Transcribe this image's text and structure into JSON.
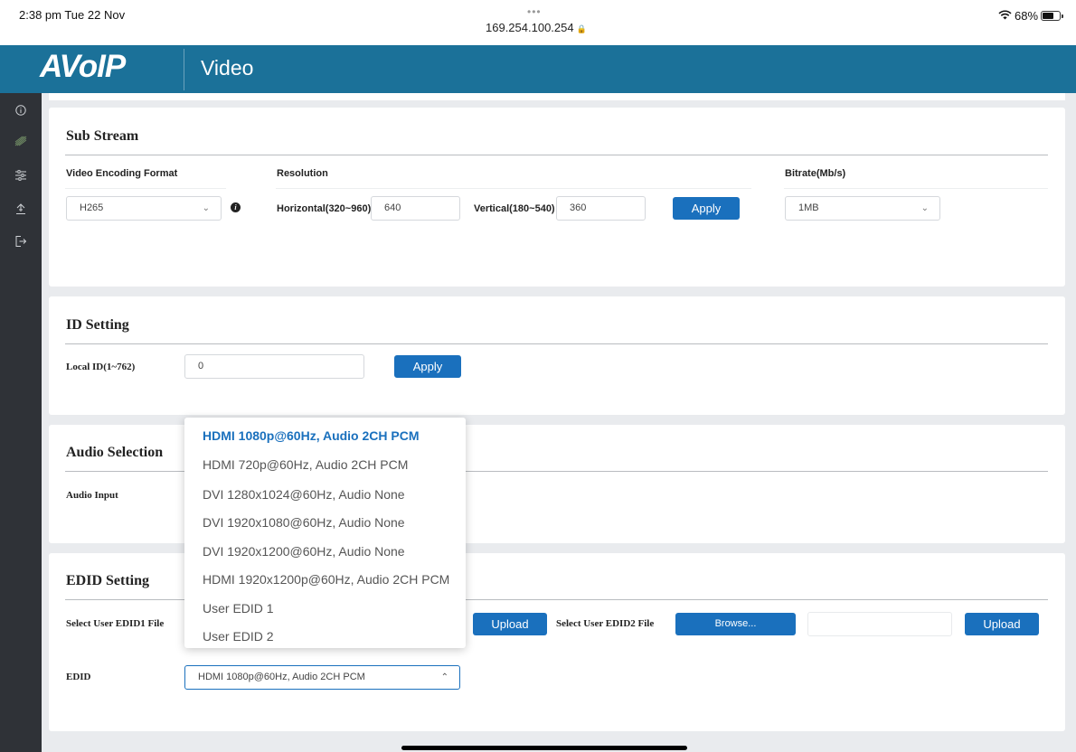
{
  "status_bar": {
    "time": "2:38 pm  Tue 22 Nov",
    "dots": "•••",
    "url": "169.254.100.254",
    "battery": "68%",
    "battery_level": 0.68
  },
  "header": {
    "logo": "AVoIP",
    "title": "Video"
  },
  "sidebar": {
    "items": [
      {
        "icon": "info-icon"
      },
      {
        "icon": "video-icon"
      },
      {
        "icon": "sliders-icon"
      },
      {
        "icon": "upgrade-icon"
      },
      {
        "icon": "logout-icon"
      }
    ]
  },
  "sub_stream": {
    "title": "Sub Stream",
    "encoding_label": "Video Encoding Format",
    "encoding_value": "H265",
    "resolution_label": "Resolution",
    "horizontal_label": "Horizontal(320~960)",
    "horizontal_value": "640",
    "vertical_label": "Vertical(180~540)",
    "vertical_value": "360",
    "apply_label": "Apply",
    "bitrate_label": "Bitrate(Mb/s)",
    "bitrate_value": "1MB"
  },
  "id_setting": {
    "title": "ID Setting",
    "local_id_label": "Local ID(1~762)",
    "local_id_value": "0",
    "apply_label": "Apply"
  },
  "audio_selection": {
    "title": "Audio Selection",
    "audio_input_label": "Audio Input"
  },
  "edid_setting": {
    "title": "EDID Setting",
    "edid1_label": "Select User EDID1 File",
    "upload1_label": "Upload",
    "edid2_label": "Select User EDID2 File",
    "browse_label": "Browse...",
    "upload2_label": "Upload",
    "edid_label": "EDID",
    "edid_value": "HDMI 1080p@60Hz, Audio 2CH PCM"
  },
  "edid_dropdown": {
    "options": [
      "HDMI 1080p@60Hz, Audio 2CH PCM",
      "HDMI 720p@60Hz, Audio 2CH PCM",
      "DVI 1280x1024@60Hz, Audio None",
      "DVI 1920x1080@60Hz, Audio None",
      "DVI 1920x1200@60Hz, Audio None",
      "HDMI 1920x1200p@60Hz, Audio 2CH PCM",
      "User EDID 1",
      "User EDID 2"
    ],
    "selected_index": 0
  },
  "colors": {
    "header_bg": "#1b7199",
    "sidebar_bg": "#2f3237",
    "accent": "#1a70bd"
  }
}
